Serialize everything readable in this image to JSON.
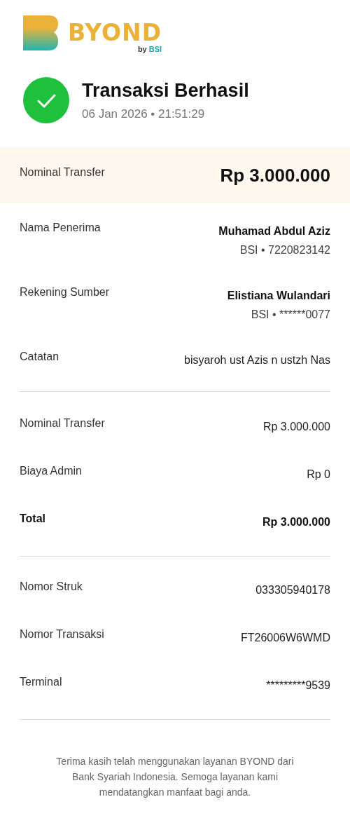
{
  "logo": {
    "wordmark": "BYOND",
    "byline": "by",
    "brand": "BSI"
  },
  "status": {
    "title": "Transaksi Berhasil",
    "datetime": "06 Jan 2026 • 21:51:29"
  },
  "amount": {
    "label": "Nominal Transfer",
    "value": "Rp 3.000.000"
  },
  "parties": [
    {
      "label": "Nama Penerima",
      "value": "Muhamad Abdul Aziz",
      "sub": "BSI • 7220823142"
    },
    {
      "label": "Rekening Sumber",
      "value": "Elistiana Wulandari",
      "sub": "BSI • ******0077"
    },
    {
      "label": "Catatan",
      "value": "bisyaroh ust Azis n ustzh Nas"
    }
  ],
  "breakdown": [
    {
      "label": "Nominal Transfer",
      "value": "Rp 3.000.000",
      "kind": "plain"
    },
    {
      "label": "Biaya Admin",
      "value": "Rp 0",
      "kind": "plain"
    },
    {
      "label": "Total",
      "value": "Rp 3.000.000",
      "kind": "total"
    }
  ],
  "references": [
    {
      "label": "Nomor Struk",
      "value": "033305940178"
    },
    {
      "label": "Nomor Transaksi",
      "value": "FT26006W6WMD"
    },
    {
      "label": "Terminal",
      "value": "*********9539"
    }
  ],
  "footer": "Terima kasih telah menggunakan layanan BYOND dari Bank Syariah Indonesia. Semoga layanan kami mendatangkan manfaat bagi anda."
}
